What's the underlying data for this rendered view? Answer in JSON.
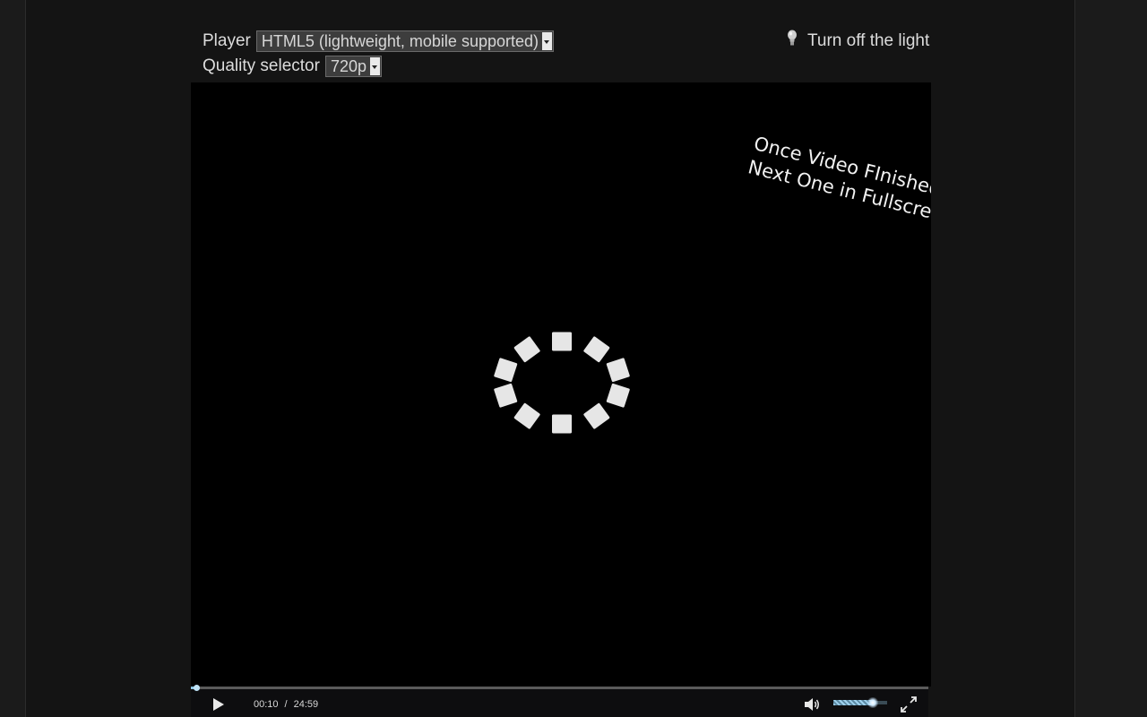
{
  "player_row": {
    "label": "Player",
    "selected": "HTML5 (lightweight, mobile supported)"
  },
  "quality_row": {
    "label": "Quality selector",
    "selected": "720p"
  },
  "light_toggle": {
    "label": "Turn off the light",
    "icon": "bulb-icon"
  },
  "video": {
    "overlay_lines": [
      "Once Video FInished Plays",
      "Next One in Fullscreen"
    ],
    "loading_icon": "loading-spinner-icon"
  },
  "control_bar": {
    "current_time": "00:10",
    "separator": "/",
    "duration": "24:59",
    "progress_fraction": 0.007,
    "volume_fraction": 0.73,
    "play_icon": "play-icon",
    "volume_icon": "speaker-icon",
    "fullscreen_icon": "fullscreen-icon"
  },
  "colors": {
    "page_background": "#1b1b1b",
    "video_background": "#000000",
    "accent": "#8cc4e4",
    "text": "#dcdcdc"
  }
}
